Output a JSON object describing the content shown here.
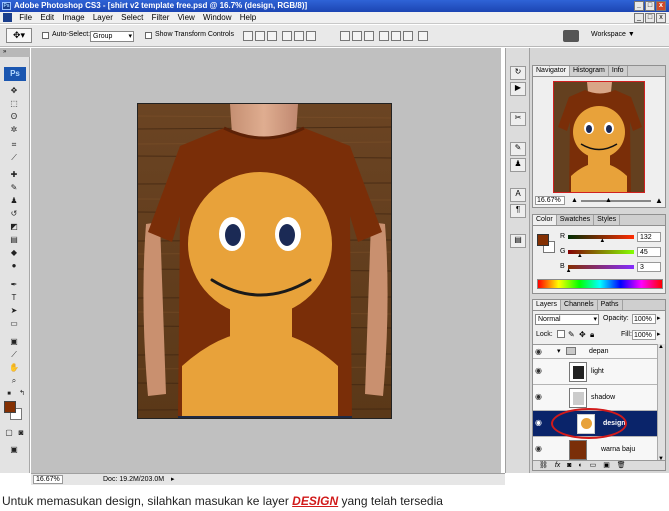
{
  "window": {
    "title": "Adobe Photoshop CS3 - [shirt v2 template free.psd @ 16.7% (design, RGB/8)]",
    "controls": [
      "_",
      "□",
      "x"
    ],
    "doc_controls": [
      "_",
      "□",
      "x"
    ]
  },
  "menu": [
    "File",
    "Edit",
    "Image",
    "Layer",
    "Select",
    "Filter",
    "View",
    "Window",
    "Help"
  ],
  "options_bar": {
    "auto_select_label": "Auto-Select:",
    "auto_select_value": "Group",
    "transform_label": "Show Transform Controls",
    "workspace_label": "Workspace ▼"
  },
  "toolbar": {
    "logo": "Ps"
  },
  "status_bar": {
    "zoom": "16.67%",
    "doc_info": "Doc: 19.2M/203.0M"
  },
  "navigator": {
    "tabs": [
      "Navigator",
      "Histogram",
      "Info"
    ],
    "zoom": "16.67%"
  },
  "color_panel": {
    "tabs": [
      "Color",
      "Swatches",
      "Styles"
    ],
    "channels": [
      {
        "label": "R",
        "value": "132",
        "position": 0.52
      },
      {
        "label": "G",
        "value": "45",
        "position": 0.18
      },
      {
        "label": "B",
        "value": "3",
        "position": 0.01
      }
    ],
    "foreground": "#843003"
  },
  "layers_panel": {
    "tabs": [
      "Layers",
      "Channels",
      "Paths"
    ],
    "blend_mode": "Normal",
    "opacity_label": "Opacity:",
    "opacity": "100%",
    "lock_label": "Lock:",
    "fill_label": "Fill:",
    "fill": "100%",
    "group": "depan",
    "layers": [
      {
        "name": "light"
      },
      {
        "name": "shadow"
      },
      {
        "name": "design",
        "selected": true
      },
      {
        "name": "warna baju"
      }
    ]
  },
  "caption": {
    "before": "Untuk memasukan design, silahkan masukan ke layer ",
    "highlight": "DESIGN",
    "after": " yang telah tersedia"
  },
  "colors": {
    "shirt": "#7a2e08",
    "design": "#e8a23a",
    "selection": "#0a246a",
    "annotation": "#d11a1a"
  }
}
